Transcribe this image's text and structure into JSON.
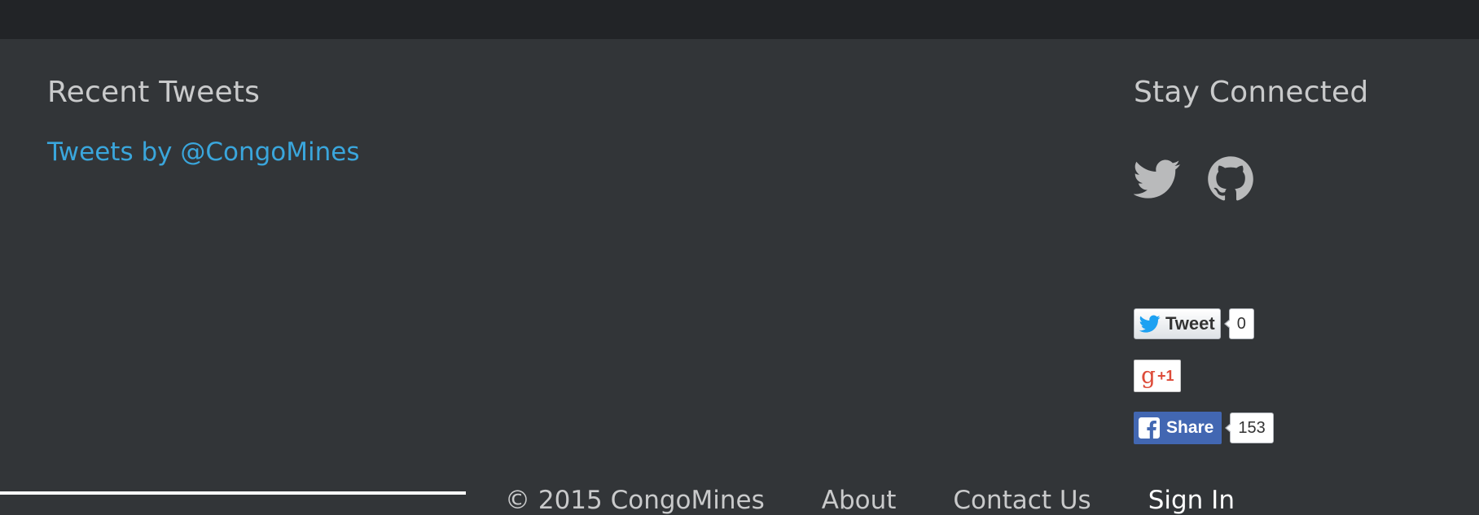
{
  "left": {
    "heading": "Recent Tweets",
    "link": "Tweets by @CongoMines"
  },
  "right": {
    "heading": "Stay Connected",
    "icons": [
      "twitter-icon",
      "github-icon"
    ],
    "tweet": {
      "label": "Tweet",
      "count": "0"
    },
    "gplus": {
      "label": "+1"
    },
    "facebook": {
      "label": "Share",
      "count": "153"
    }
  },
  "footer_nav": {
    "copyright": "© 2015 CongoMines",
    "about": "About",
    "contact": "Contact Us",
    "signin": "Sign In"
  },
  "colors": {
    "background": "#323538",
    "top_bar": "#222427",
    "link": "#3aa6dc",
    "heading": "#c9cacb",
    "facebook": "#4267b2",
    "gplus": "#dd4b39"
  }
}
